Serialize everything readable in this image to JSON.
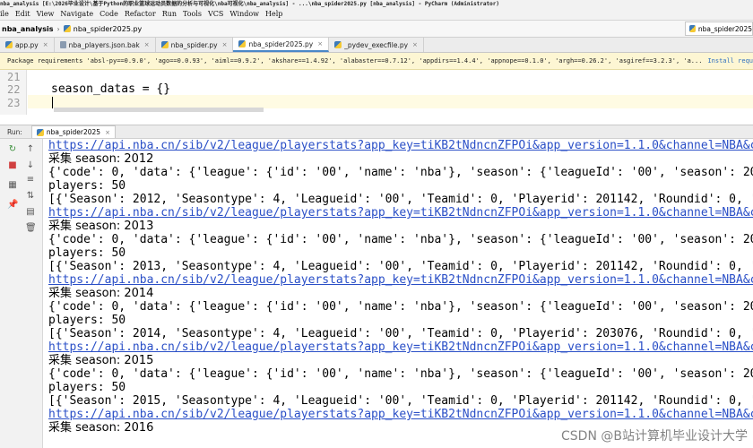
{
  "window": {
    "title": "nba_analysis [E:\\2026毕业设计\\基于Python的职业篮球运动员数据的分析与可视化\\nba可视化\\nba_analysis] - ...\\nba_spider2025.py [nba_analysis] - PyCharm (Administrator)"
  },
  "menu": [
    "ile",
    "Edit",
    "View",
    "Navigate",
    "Code",
    "Refactor",
    "Run",
    "Tools",
    "VCS",
    "Window",
    "Help"
  ],
  "breadcrumb": {
    "project": "nba_analysis",
    "file": "nba_spider2025.py"
  },
  "run_config": "nba_spider2025",
  "tabs": [
    "app.py",
    "nba_players.json.bak",
    "nba_spider.py",
    "nba_spider2025.py",
    "_pydev_execfile.py"
  ],
  "active_tab_index": 3,
  "banner": {
    "text": "Package requirements 'absl-py==0.9.0', 'ago==0.0.93', 'aiml==0.9.2', 'akshare==1.4.92', 'alabaster==0.7.12', 'appdirs==1.4.4', 'appnope==0.1.0', 'argh==0.26.2', 'asgiref==3.2.3', 'a...",
    "link": "Install requirements"
  },
  "editor": {
    "line_numbers": [
      "21",
      "22",
      "23"
    ],
    "lines": [
      "",
      "season_datas = {}",
      ""
    ]
  },
  "run_panel": {
    "label": "Run:",
    "tab": "nba_spider2025"
  },
  "console": [
    {
      "text": "https://api.nba.cn/sib/v2/league/playerstats?app_key=tiKB2tNdncnZFPOi&app_version=1.1.0&channel=NBA&c",
      "type": "url"
    },
    {
      "text": "采集 season:  2012",
      "type": "cjk"
    },
    {
      "text": "{'code': 0, 'data': {'league': {'id': '00', 'name': 'nba'}, 'season': {'leagueId': '00', 'season': 20",
      "type": "plain"
    },
    {
      "text": "players: 50",
      "type": "plain"
    },
    {
      "text": "[{'Season': 2012, 'Seasontype': 4, 'Leagueid': '00', 'Teamid': 0, 'Playerid': 201142, 'Roundid': 0, '",
      "type": "plain"
    },
    {
      "text": "https://api.nba.cn/sib/v2/league/playerstats?app_key=tiKB2tNdncnZFPOi&app_version=1.1.0&channel=NBA&c",
      "type": "url"
    },
    {
      "text": "采集 season:  2013",
      "type": "cjk"
    },
    {
      "text": "{'code': 0, 'data': {'league': {'id': '00', 'name': 'nba'}, 'season': {'leagueId': '00', 'season': 20",
      "type": "plain"
    },
    {
      "text": "players: 50",
      "type": "plain"
    },
    {
      "text": "[{'Season': 2013, 'Seasontype': 4, 'Leagueid': '00', 'Teamid': 0, 'Playerid': 201142, 'Roundid': 0, '",
      "type": "plain"
    },
    {
      "text": "https://api.nba.cn/sib/v2/league/playerstats?app_key=tiKB2tNdncnZFPOi&app_version=1.1.0&channel=NBA&c",
      "type": "url"
    },
    {
      "text": "采集 season:  2014",
      "type": "cjk"
    },
    {
      "text": "{'code': 0, 'data': {'league': {'id': '00', 'name': 'nba'}, 'season': {'leagueId': '00', 'season': 20",
      "type": "plain"
    },
    {
      "text": "players: 50",
      "type": "plain"
    },
    {
      "text": "[{'Season': 2014, 'Seasontype': 4, 'Leagueid': '00', 'Teamid': 0, 'Playerid': 203076, 'Roundid': 0, '",
      "type": "plain"
    },
    {
      "text": "https://api.nba.cn/sib/v2/league/playerstats?app_key=tiKB2tNdncnZFPOi&app_version=1.1.0&channel=NBA&c",
      "type": "url"
    },
    {
      "text": "采集 season:  2015",
      "type": "cjk"
    },
    {
      "text": "{'code': 0, 'data': {'league': {'id': '00', 'name': 'nba'}, 'season': {'leagueId': '00', 'season': 20",
      "type": "plain"
    },
    {
      "text": "players: 50",
      "type": "plain"
    },
    {
      "text": "[{'Season': 2015, 'Seasontype': 4, 'Leagueid': '00', 'Teamid': 0, 'Playerid': 201142, 'Roundid': 0, '",
      "type": "plain"
    },
    {
      "text": "https://api.nba.cn/sib/v2/league/playerstats?app_key=tiKB2tNdncnZFPOi&app_version=1.1.0&channel=NBA&c",
      "type": "url"
    },
    {
      "text": "采集 season:  2016",
      "type": "cjk"
    }
  ],
  "watermark": "CSDN @B站计算机毕业设计大学",
  "colors": {
    "link": "#2a4fc7",
    "banner_bg": "#fdf6d3",
    "active_tab_underline": "#4a88c7"
  },
  "tools": [
    "rerun-icon",
    "stop-icon",
    "scroll-up-icon",
    "scroll-down-icon",
    "layout-icon",
    "soft-wrap-icon",
    "sort-icon",
    "pin-icon",
    "print-icon",
    "trash-icon"
  ]
}
